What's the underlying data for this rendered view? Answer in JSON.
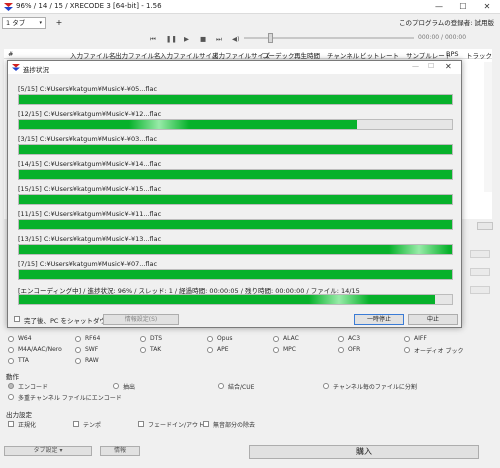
{
  "window": {
    "title": "96% / 14 / 15 / XRECODE 3 [64-bit] - 1.56"
  },
  "menubar": {
    "tab_label": "1 タブ",
    "add_tab": "+",
    "registrant": "このプログラムの登録者: 試用版"
  },
  "player": {
    "time": "000:00 / 000:00"
  },
  "columns": [
    "#",
    "入力ファイル名",
    "出力ファイル名",
    "入力ファイルサイズ",
    "出力ファイルサイズ",
    "コーデック",
    "再生時間",
    "チャンネル",
    "ビットレート",
    "サンプルレート",
    "BPS",
    "トラック"
  ],
  "formats": {
    "row1": [
      "W64",
      "RF64",
      "DTS",
      "Opus",
      "ALAC",
      "AC3",
      "AIFF"
    ],
    "row2": [
      "M4A/AAC/Nero",
      "SWF",
      "TAK",
      "APE",
      "MPC",
      "OFR",
      "オーディオ ブック"
    ],
    "row3": [
      "TTA",
      "RAW"
    ]
  },
  "action": {
    "section": "動作",
    "options": [
      "エンコード",
      "抽出",
      "結合/CUE",
      "チャンネル毎のファイルに分割",
      "多重チャンネル ファイルにエンコード"
    ]
  },
  "output": {
    "section": "出力設定",
    "options": [
      "正規化",
      "テンポ",
      "フェードイン/アウト",
      "無音部分の除去"
    ]
  },
  "bottom": {
    "tab_settings": "タブ設定",
    "info": "情報",
    "convert": "購入"
  },
  "dialog": {
    "title": "進捗状況",
    "rows": [
      {
        "label": "[5/15] C:¥Users¥katgum¥Music¥-¥05...flac",
        "progress": 1.0
      },
      {
        "label": "[12/15] C:¥Users¥katgum¥Music¥-¥12...flac",
        "progress": 0.78
      },
      {
        "label": "[3/15] C:¥Users¥katgum¥Music¥-¥03...flac",
        "progress": 1.0
      },
      {
        "label": "[14/15] C:¥Users¥katgum¥Music¥-¥14...flac",
        "progress": 1.0
      },
      {
        "label": "[15/15] C:¥Users¥katgum¥Music¥-¥15...flac",
        "progress": 1.0
      },
      {
        "label": "[11/15] C:¥Users¥katgum¥Music¥-¥11...flac",
        "progress": 1.0
      },
      {
        "label": "[13/15] C:¥Users¥katgum¥Music¥-¥13...flac",
        "progress": 1.0
      },
      {
        "label": "[7/15] C:¥Users¥katgum¥Music¥-¥07...flac",
        "progress": 1.0
      }
    ],
    "overall": {
      "label": "[エンコーディング中] / 進捗状況: 96% / スレッド: 1 / 経過時間: 00:00:05 / 残り時間: 00:00:00 / ファイル: 14/15",
      "progress": 0.96
    },
    "shutdown": "完了後、PC をシャットダウン",
    "settings": "情報設定(S)",
    "pause": "一時停止",
    "cancel": "中止"
  },
  "colors": {
    "progress": "#07b12b",
    "logo_red": "#d02020",
    "logo_blue": "#2244cc"
  }
}
